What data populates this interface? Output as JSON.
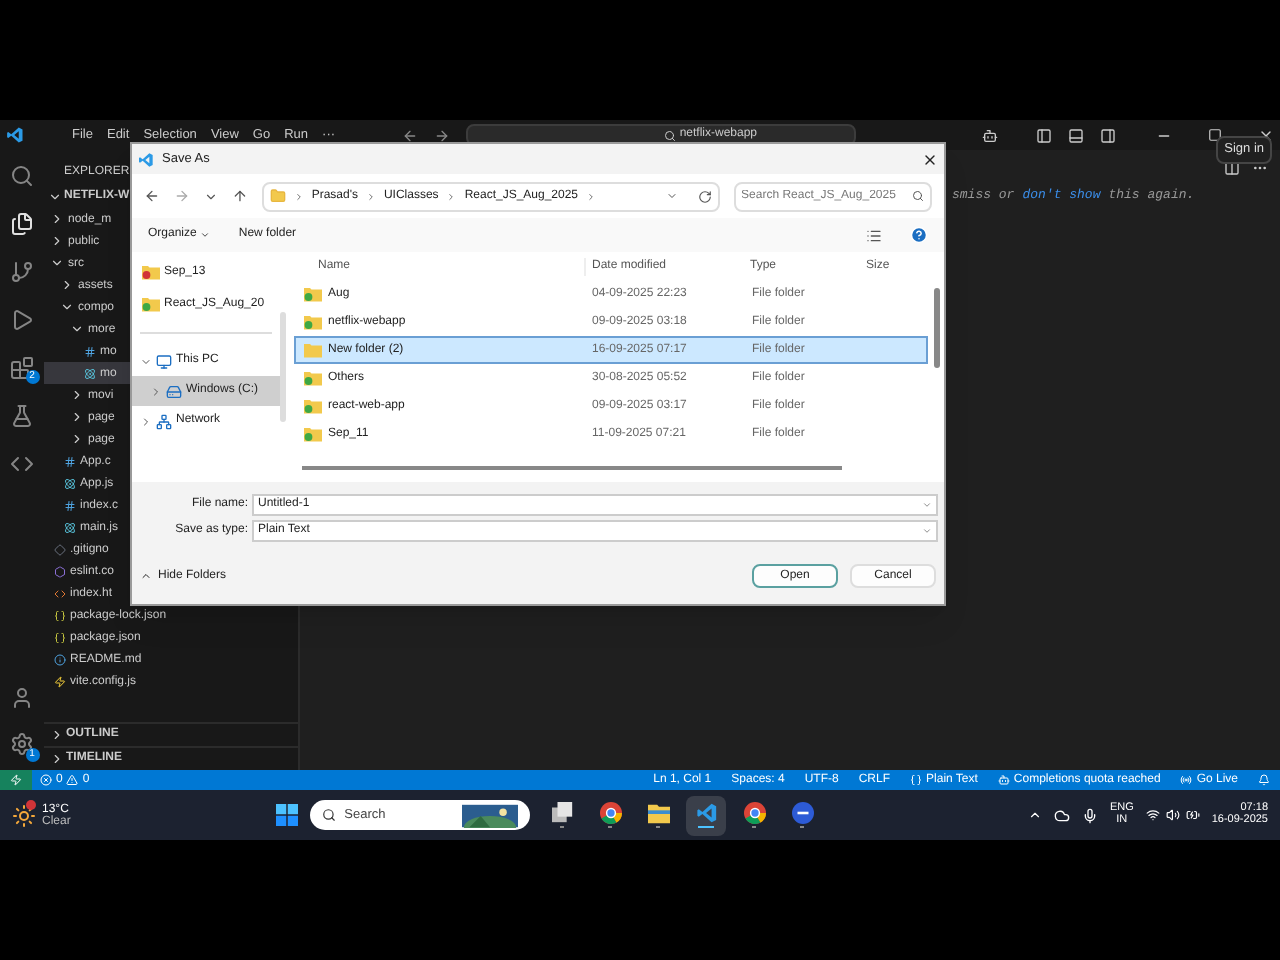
{
  "vscode": {
    "menu": [
      "File",
      "Edit",
      "Selection",
      "View",
      "Go",
      "Run",
      "···"
    ],
    "command_center": "netflix-webapp",
    "sign_in_tooltip": "Sign in",
    "extensions_badge": "2",
    "settings_badge": "1",
    "activity": [
      {
        "kind": "search",
        "selected": false
      },
      {
        "kind": "explorer",
        "selected": true
      },
      {
        "kind": "scm",
        "selected": false
      },
      {
        "kind": "run",
        "selected": false
      },
      {
        "kind": "extensions",
        "selected": false
      },
      {
        "kind": "testing",
        "selected": false
      },
      {
        "kind": "python",
        "selected": false
      }
    ],
    "editor_hint": [
      {
        "text": "smiss or",
        "kind": "plain"
      },
      {
        "text": "don't show",
        "kind": "link"
      },
      {
        "text": "this again.",
        "kind": "plain"
      }
    ]
  },
  "sidebar": {
    "title": "EXPLORER",
    "project": "NETFLIX-W",
    "tree": [
      {
        "label": "node_m",
        "kind": "folder",
        "expanded": false,
        "selected": false
      },
      {
        "label": "public",
        "kind": "folder",
        "expanded": false,
        "selected": false
      },
      {
        "label": "src",
        "kind": "folder",
        "expanded": true,
        "selected": false,
        "children": [
          {
            "label": "assets",
            "kind": "folder",
            "expanded": false,
            "selected": false
          },
          {
            "label": "compo",
            "kind": "folder",
            "expanded": true,
            "selected": false,
            "children": [
              {
                "label": "more",
                "kind": "folder",
                "expanded": true,
                "selected": false,
                "children": [
                  {
                    "label": "mo",
                    "kind": "css",
                    "selected": false
                  },
                  {
                    "label": "mo",
                    "kind": "jsx",
                    "selected": true
                  }
                ]
              },
              {
                "label": "movi",
                "kind": "folder",
                "expanded": false,
                "selected": false
              },
              {
                "label": "page",
                "kind": "folder",
                "expanded": false,
                "selected": false
              },
              {
                "label": "page",
                "kind": "folder",
                "expanded": false,
                "selected": false
              }
            ]
          },
          {
            "label": "App.c",
            "kind": "css",
            "selected": false
          },
          {
            "label": "App.js",
            "kind": "jsx",
            "selected": false
          },
          {
            "label": "index.c",
            "kind": "css",
            "selected": false
          },
          {
            "label": "main.js",
            "kind": "jsx",
            "selected": false
          }
        ]
      },
      {
        "label": ".gitigno",
        "kind": "git",
        "selected": false
      },
      {
        "label": "eslint.co",
        "kind": "eslint",
        "selected": false
      },
      {
        "label": "index.ht",
        "kind": "html",
        "selected": false
      },
      {
        "label": "package-lock.json",
        "kind": "json",
        "selected": false
      },
      {
        "label": "package.json",
        "kind": "json",
        "selected": false
      },
      {
        "label": "README.md",
        "kind": "info",
        "selected": false
      },
      {
        "label": "vite.config.js",
        "kind": "vite",
        "selected": false
      }
    ],
    "sections": [
      {
        "label": "OUTLINE",
        "expanded": false
      },
      {
        "label": "TIMELINE",
        "expanded": false
      }
    ]
  },
  "dialog": {
    "title": "Save As",
    "breadcrumb": [
      "Prasad's",
      "UIClasses",
      "React_JS_Aug_2025"
    ],
    "search": {
      "placeholder": "Search React_JS_Aug_2025"
    },
    "toolbar": [
      "Organize",
      "New folder"
    ],
    "quick_access": [
      {
        "label": "Sep_13",
        "kind": "error"
      },
      {
        "label": "React_JS_Aug_20",
        "kind": "synced"
      }
    ],
    "locations": [
      {
        "label": "This PC",
        "kind": "pc",
        "expanded": true,
        "selected": false,
        "children": [
          {
            "label": "Windows (C:)",
            "kind": "drive",
            "expanded": false,
            "selected": true
          }
        ]
      },
      {
        "label": "Network",
        "kind": "network",
        "expanded": false,
        "selected": false
      }
    ],
    "columns": [
      "Name",
      "Date modified",
      "Type",
      "Size"
    ],
    "rows": [
      {
        "name": "Aug",
        "date": "04-09-2025 22:23",
        "type": "File folder",
        "kind": "synced",
        "selected": false
      },
      {
        "name": "netflix-webapp",
        "date": "09-09-2025 03:18",
        "type": "File folder",
        "kind": "synced",
        "selected": false
      },
      {
        "name": "New folder (2)",
        "date": "16-09-2025 07:17",
        "type": "File folder",
        "kind": "plain",
        "selected": true
      },
      {
        "name": "Others",
        "date": "30-08-2025 05:52",
        "type": "File folder",
        "kind": "synced",
        "selected": false
      },
      {
        "name": "react-web-app",
        "date": "09-09-2025 03:17",
        "type": "File folder",
        "kind": "synced",
        "selected": false
      },
      {
        "name": "Sep_11",
        "date": "11-09-2025 07:21",
        "type": "File folder",
        "kind": "synced",
        "selected": false
      }
    ],
    "file_name": {
      "label": "File name:",
      "value": "Untitled-1"
    },
    "save_as_type": {
      "label": "Save as type:",
      "value": "Plain Text"
    },
    "hide_folders": "Hide Folders",
    "buttons": [
      "Open",
      "Cancel"
    ]
  },
  "status_bar": {
    "errors": "0",
    "warnings": "0",
    "items": [
      {
        "text": "Ln 1, Col 1",
        "kind": "plain"
      },
      {
        "text": "Spaces: 4",
        "kind": "plain"
      },
      {
        "text": "UTF-8",
        "kind": "plain"
      },
      {
        "text": "CRLF",
        "kind": "plain"
      },
      {
        "text": "Plain Text",
        "kind": "language"
      },
      {
        "text": "Completions quota reached",
        "kind": "copilot"
      },
      {
        "text": "Go Live",
        "kind": "live"
      },
      {
        "kind": "bell"
      }
    ]
  },
  "taskbar": {
    "temperature": "13°C",
    "condition": "Clear",
    "search": "Search",
    "apps": [
      {
        "kind": "taskview",
        "active": false
      },
      {
        "kind": "chrome",
        "active": false
      },
      {
        "kind": "files",
        "active": false
      },
      {
        "kind": "vscode",
        "active": true
      },
      {
        "kind": "chrome",
        "active": false
      },
      {
        "kind": "meet",
        "active": false
      }
    ],
    "language": "ENG",
    "region": "IN",
    "time": "07:18",
    "date": "16-09-2025"
  }
}
